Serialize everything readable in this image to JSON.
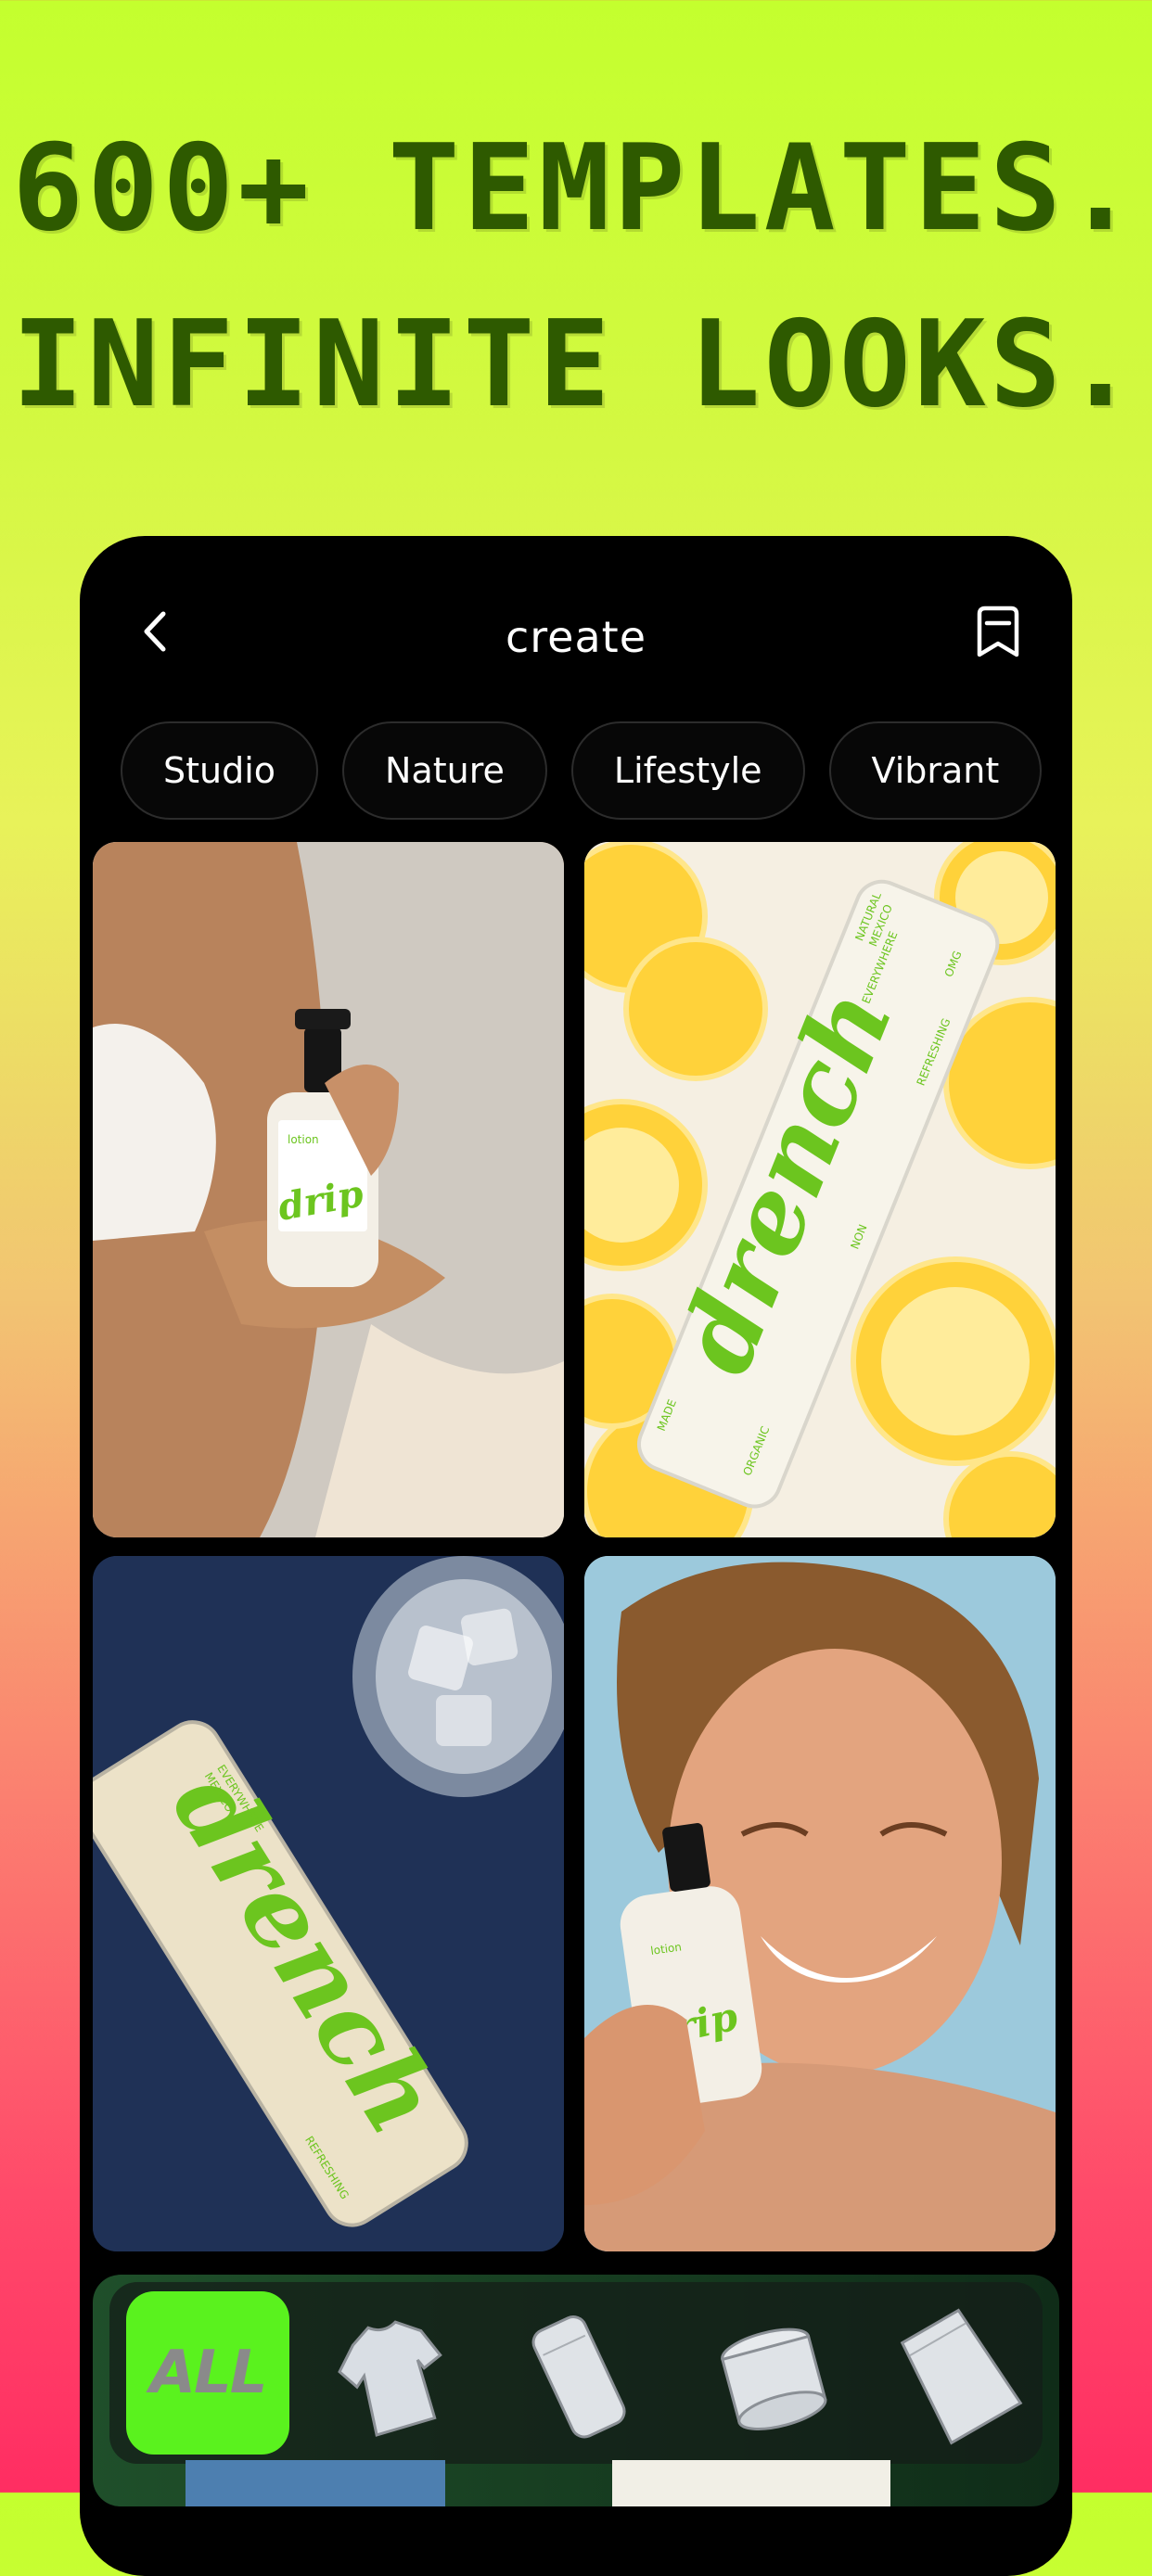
{
  "headline": {
    "line1": "600+ TEMPLATES.",
    "line2": "INFINITE LOOKS."
  },
  "app": {
    "title": "create",
    "back_icon": "chevron-left-icon",
    "bookmark_icon": "bookmark-icon"
  },
  "categories": [
    "Studio",
    "Nature",
    "Lifestyle",
    "Vibrant"
  ],
  "templates": [
    {
      "brand": "drip",
      "product_label": "lotion"
    },
    {
      "brand": "drench",
      "can_texts": [
        "NATURAL",
        "MEXICO",
        "EVERYWHERE",
        "OMG",
        "REFRESHING",
        "MADE",
        "ORGANIC",
        "NON"
      ]
    },
    {
      "brand": "drench",
      "can_texts": [
        "REFRESHING",
        "EVERYWHERE",
        "MEXICO"
      ]
    },
    {
      "brand": "drip",
      "product_label": "lotion"
    }
  ],
  "filter_bar": {
    "all_label": "ALL",
    "items": [
      "t-shirt-icon",
      "can-icon",
      "jar-icon",
      "pouch-icon"
    ]
  },
  "colors": {
    "accent_green": "#5af21e",
    "brand_green": "#6cc51f",
    "headline_green": "#2e5a00"
  }
}
